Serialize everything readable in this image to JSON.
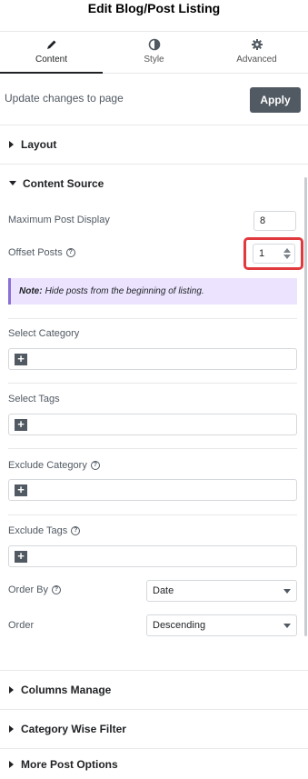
{
  "header": {
    "title": "Edit Blog/Post Listing"
  },
  "tabs": [
    {
      "label": "Content",
      "icon": "pencil-icon",
      "active": true
    },
    {
      "label": "Style",
      "icon": "contrast-icon",
      "active": false
    },
    {
      "label": "Advanced",
      "icon": "gear-icon",
      "active": false
    }
  ],
  "update": {
    "text": "Update changes to page",
    "apply_label": "Apply"
  },
  "sections": {
    "layout": "Layout",
    "content_source": "Content Source",
    "columns_manage": "Columns Manage",
    "category_wise_filter": "Category Wise Filter",
    "more_post_options": "More Post Options"
  },
  "fields": {
    "max_post_display": {
      "label": "Maximum Post Display",
      "value": "8"
    },
    "offset_posts": {
      "label": "Offset Posts",
      "value": "1"
    },
    "note": {
      "bold": "Note:",
      "text": "Hide posts from the beginning of listing."
    },
    "select_category": {
      "label": "Select Category"
    },
    "select_tags": {
      "label": "Select Tags"
    },
    "exclude_category": {
      "label": "Exclude Category"
    },
    "exclude_tags": {
      "label": "Exclude Tags"
    },
    "order_by": {
      "label": "Order By",
      "value": "Date"
    },
    "order": {
      "label": "Order",
      "value": "Descending"
    }
  },
  "colors": {
    "accent": "#515962",
    "highlight": "#e03a3e",
    "note_bg": "#ece4ff"
  }
}
